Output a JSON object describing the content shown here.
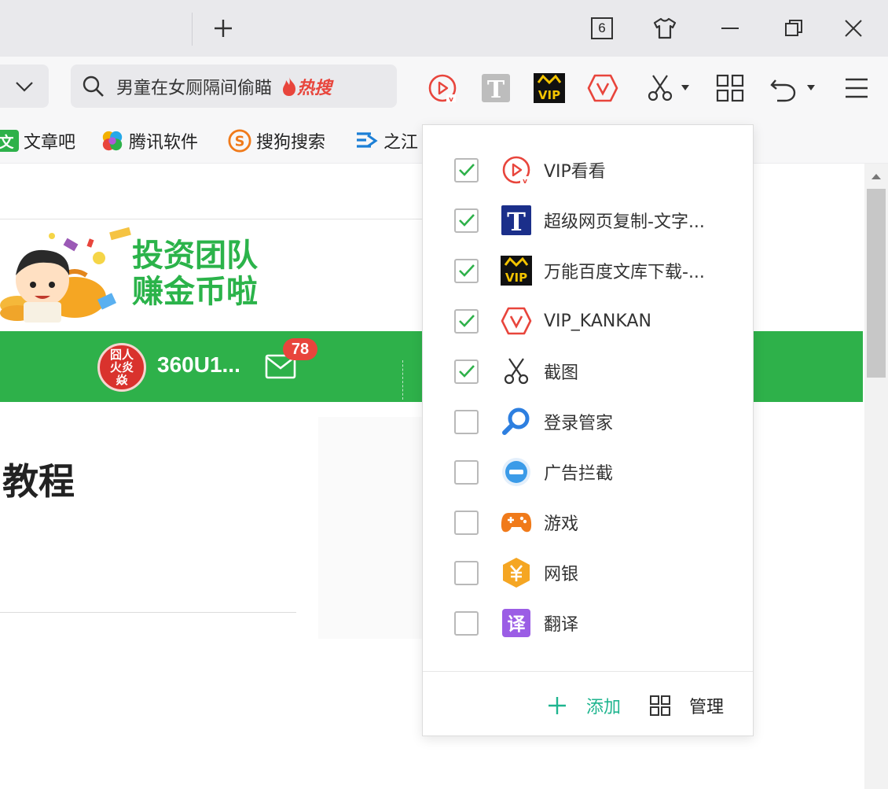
{
  "titlebar": {
    "new_tab_icon": "plus-icon",
    "tab_count": "6",
    "skin_icon": "tshirt-icon",
    "minimize_icon": "minimize-icon",
    "restore_icon": "restore-icon",
    "close_icon": "close-icon"
  },
  "toolbar": {
    "search_placeholder": "男童在女厕隔间偷瞄",
    "hot_label": "热搜",
    "icons": [
      "vip-video-icon",
      "text-copy-icon",
      "vip-doc-icon",
      "vip-kankan-icon",
      "scissors-icon",
      "apps-grid-icon",
      "undo-icon",
      "menu-icon"
    ]
  },
  "bookmarks": [
    {
      "label": "文章吧",
      "icon": "wenzhang-icon"
    },
    {
      "label": "腾讯软件",
      "icon": "tencent-icon"
    },
    {
      "label": "搜狗搜索",
      "icon": "sogou-icon"
    },
    {
      "label": "之江",
      "icon": "zhijiang-icon"
    }
  ],
  "page": {
    "banner_line1": "投资团队",
    "banner_line2": "赚金币啦",
    "avatar_text": "囧人 火炎焱",
    "username": "360U1...",
    "mail_count": "78",
    "heading": "教程",
    "brand_green": "#2eb14a"
  },
  "popup": {
    "extensions": [
      {
        "label": "VIP看看",
        "checked": true,
        "icon": "vip-video-icon"
      },
      {
        "label": "超级网页复制-文字...",
        "checked": true,
        "icon": "text-copy-icon"
      },
      {
        "label": "万能百度文库下载-...",
        "checked": true,
        "icon": "vip-doc-icon"
      },
      {
        "label": "VIP_KANKAN",
        "checked": true,
        "icon": "vip-kankan-icon"
      },
      {
        "label": "截图",
        "checked": true,
        "icon": "scissors-icon"
      },
      {
        "label": "登录管家",
        "checked": false,
        "icon": "login-manager-icon"
      },
      {
        "label": "广告拦截",
        "checked": false,
        "icon": "ad-block-icon"
      },
      {
        "label": "游戏",
        "checked": false,
        "icon": "game-icon"
      },
      {
        "label": "网银",
        "checked": false,
        "icon": "bank-icon"
      },
      {
        "label": "翻译",
        "checked": false,
        "icon": "translate-icon"
      }
    ],
    "add_label": "添加",
    "manage_label": "管理",
    "check_color": "#2eb14a"
  }
}
